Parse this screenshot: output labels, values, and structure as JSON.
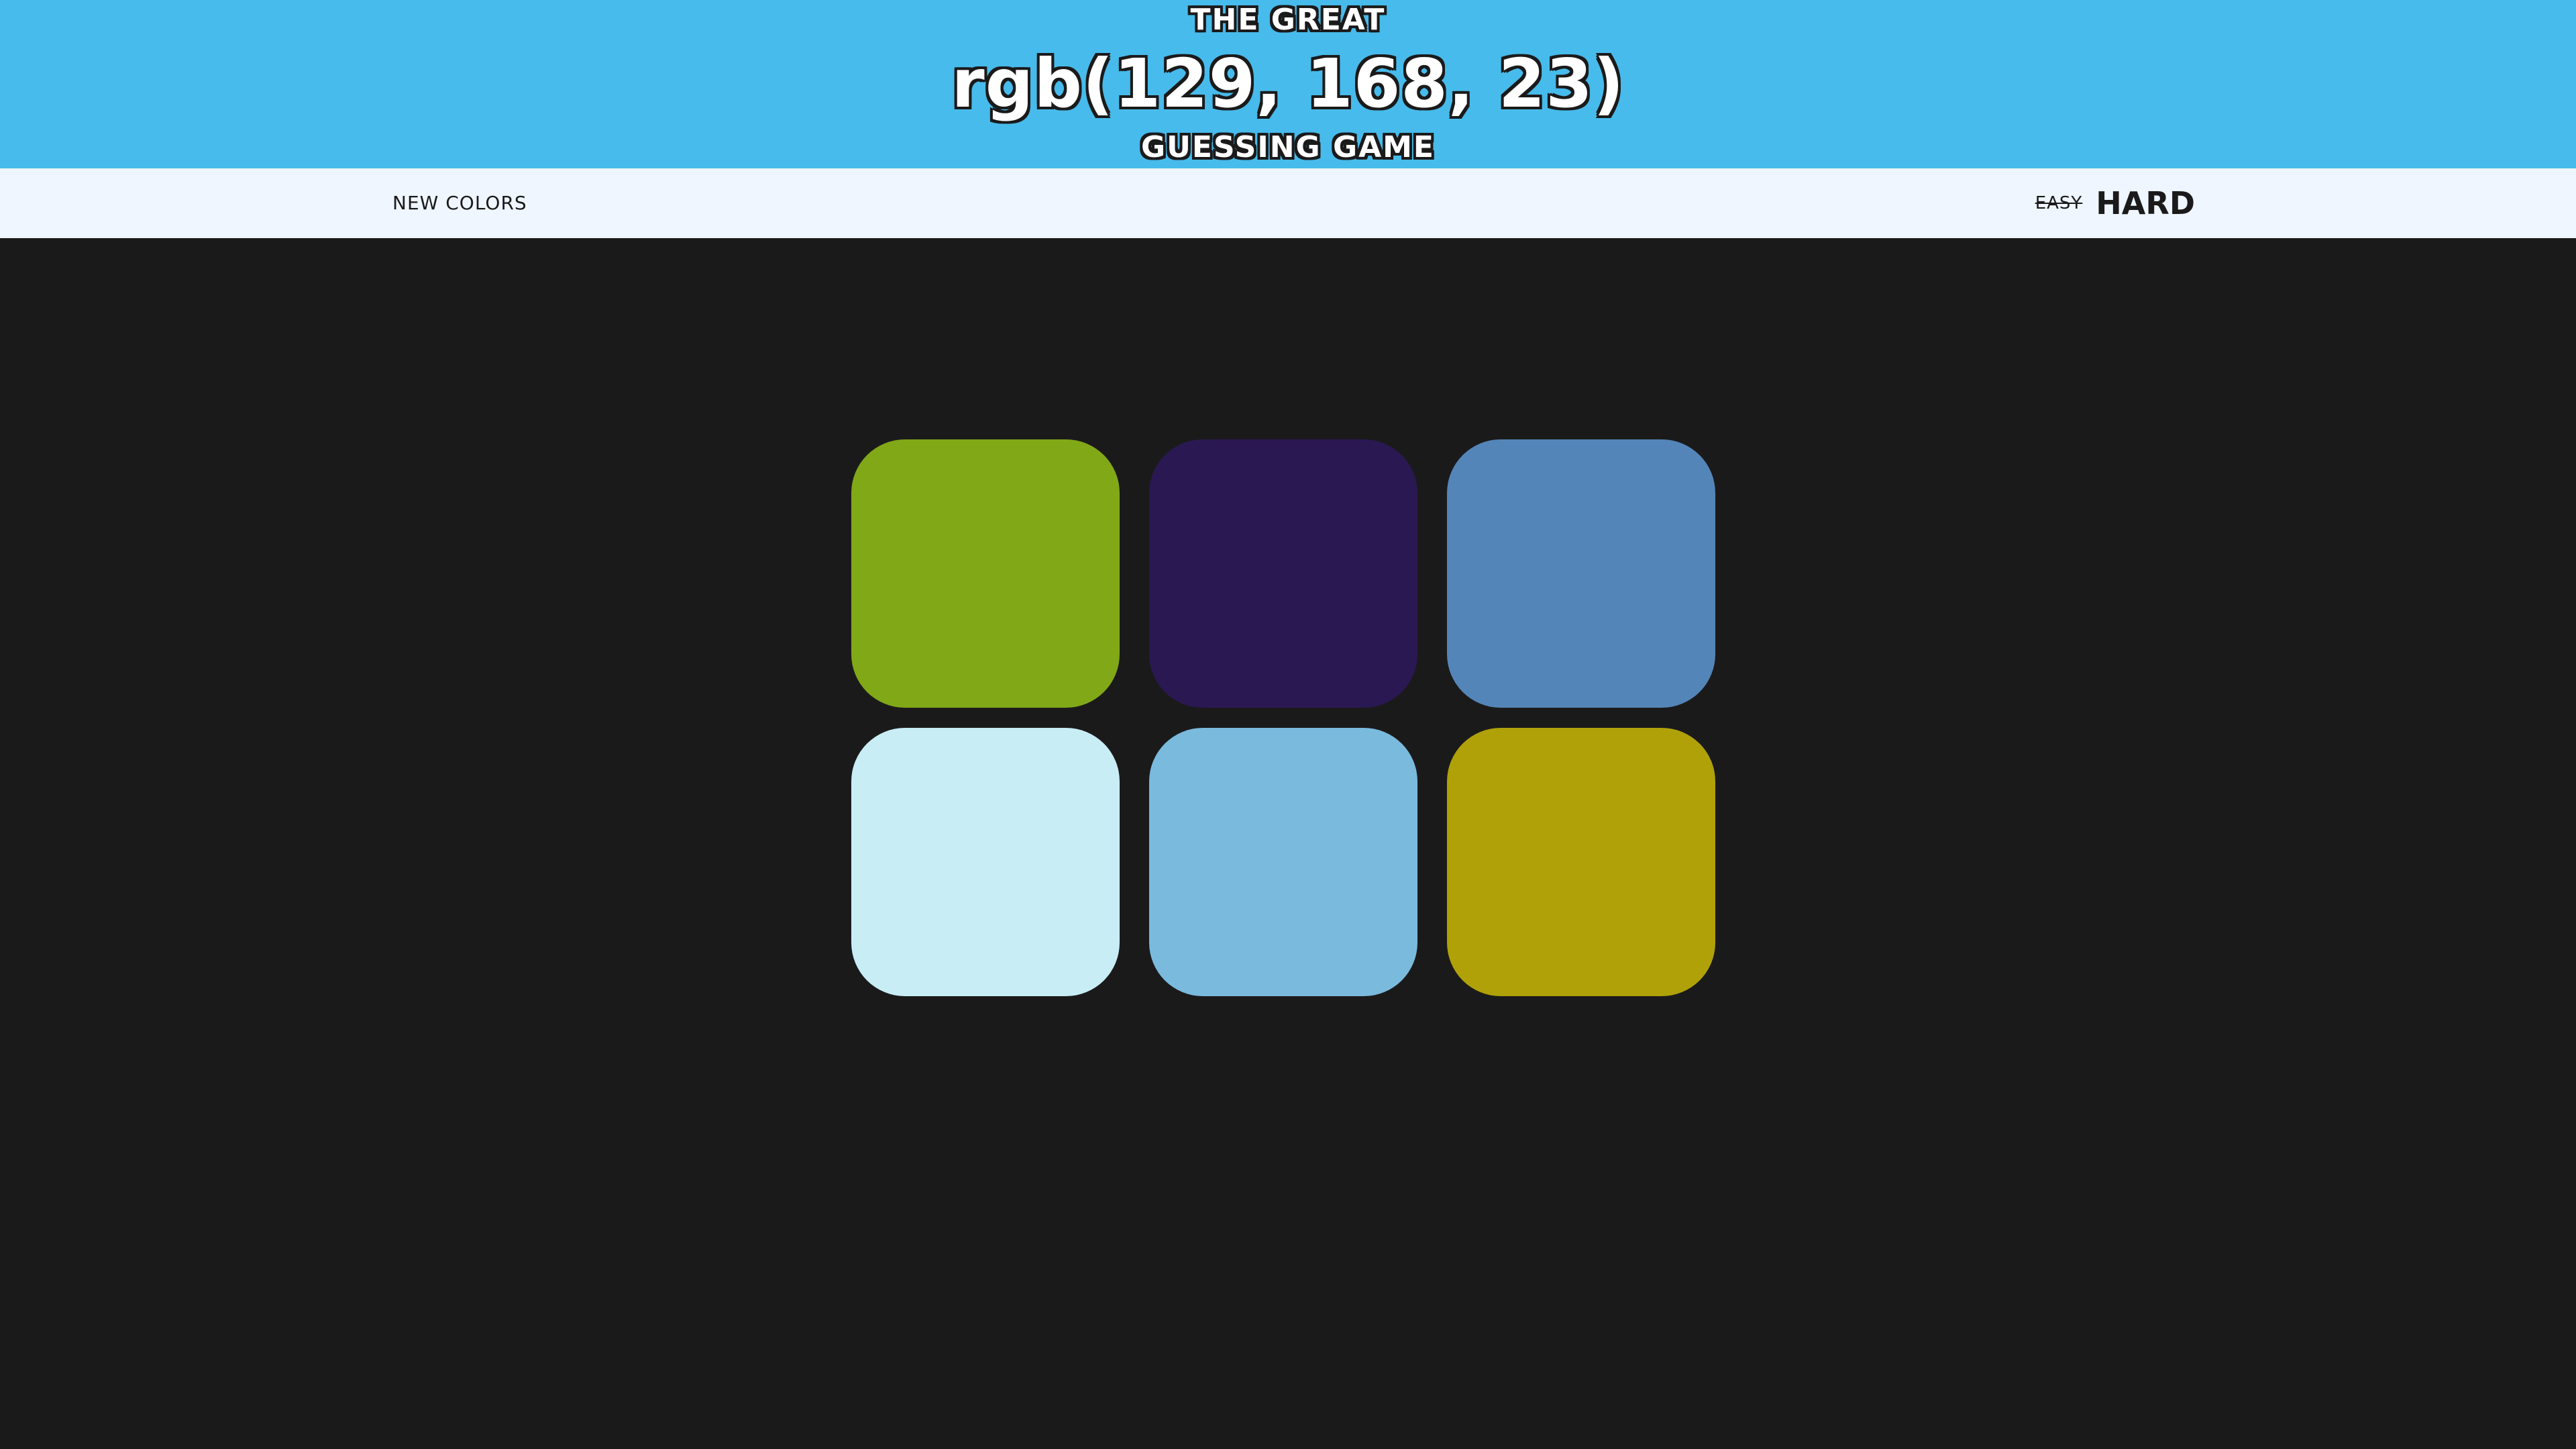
{
  "header": {
    "title_top": "THE GREAT",
    "target_rgb": "rgb(129, 168, 23)",
    "title_bottom": "GUESSING GAME",
    "background_color": "#47bbeb"
  },
  "stripe": {
    "new_colors_label": "NEW COLORS",
    "modes": [
      {
        "label": "EASY",
        "selected": false
      },
      {
        "label": "HARD",
        "selected": true
      }
    ],
    "background_color": "#eff6ff"
  },
  "board": {
    "background_color": "#1b1a1b",
    "squares": [
      {
        "color": "#81a817"
      },
      {
        "color": "#2a1852"
      },
      {
        "color": "#5485b8"
      },
      {
        "color": "#c8edf5"
      },
      {
        "color": "#7abadd"
      },
      {
        "color": "#b0a108"
      }
    ]
  }
}
